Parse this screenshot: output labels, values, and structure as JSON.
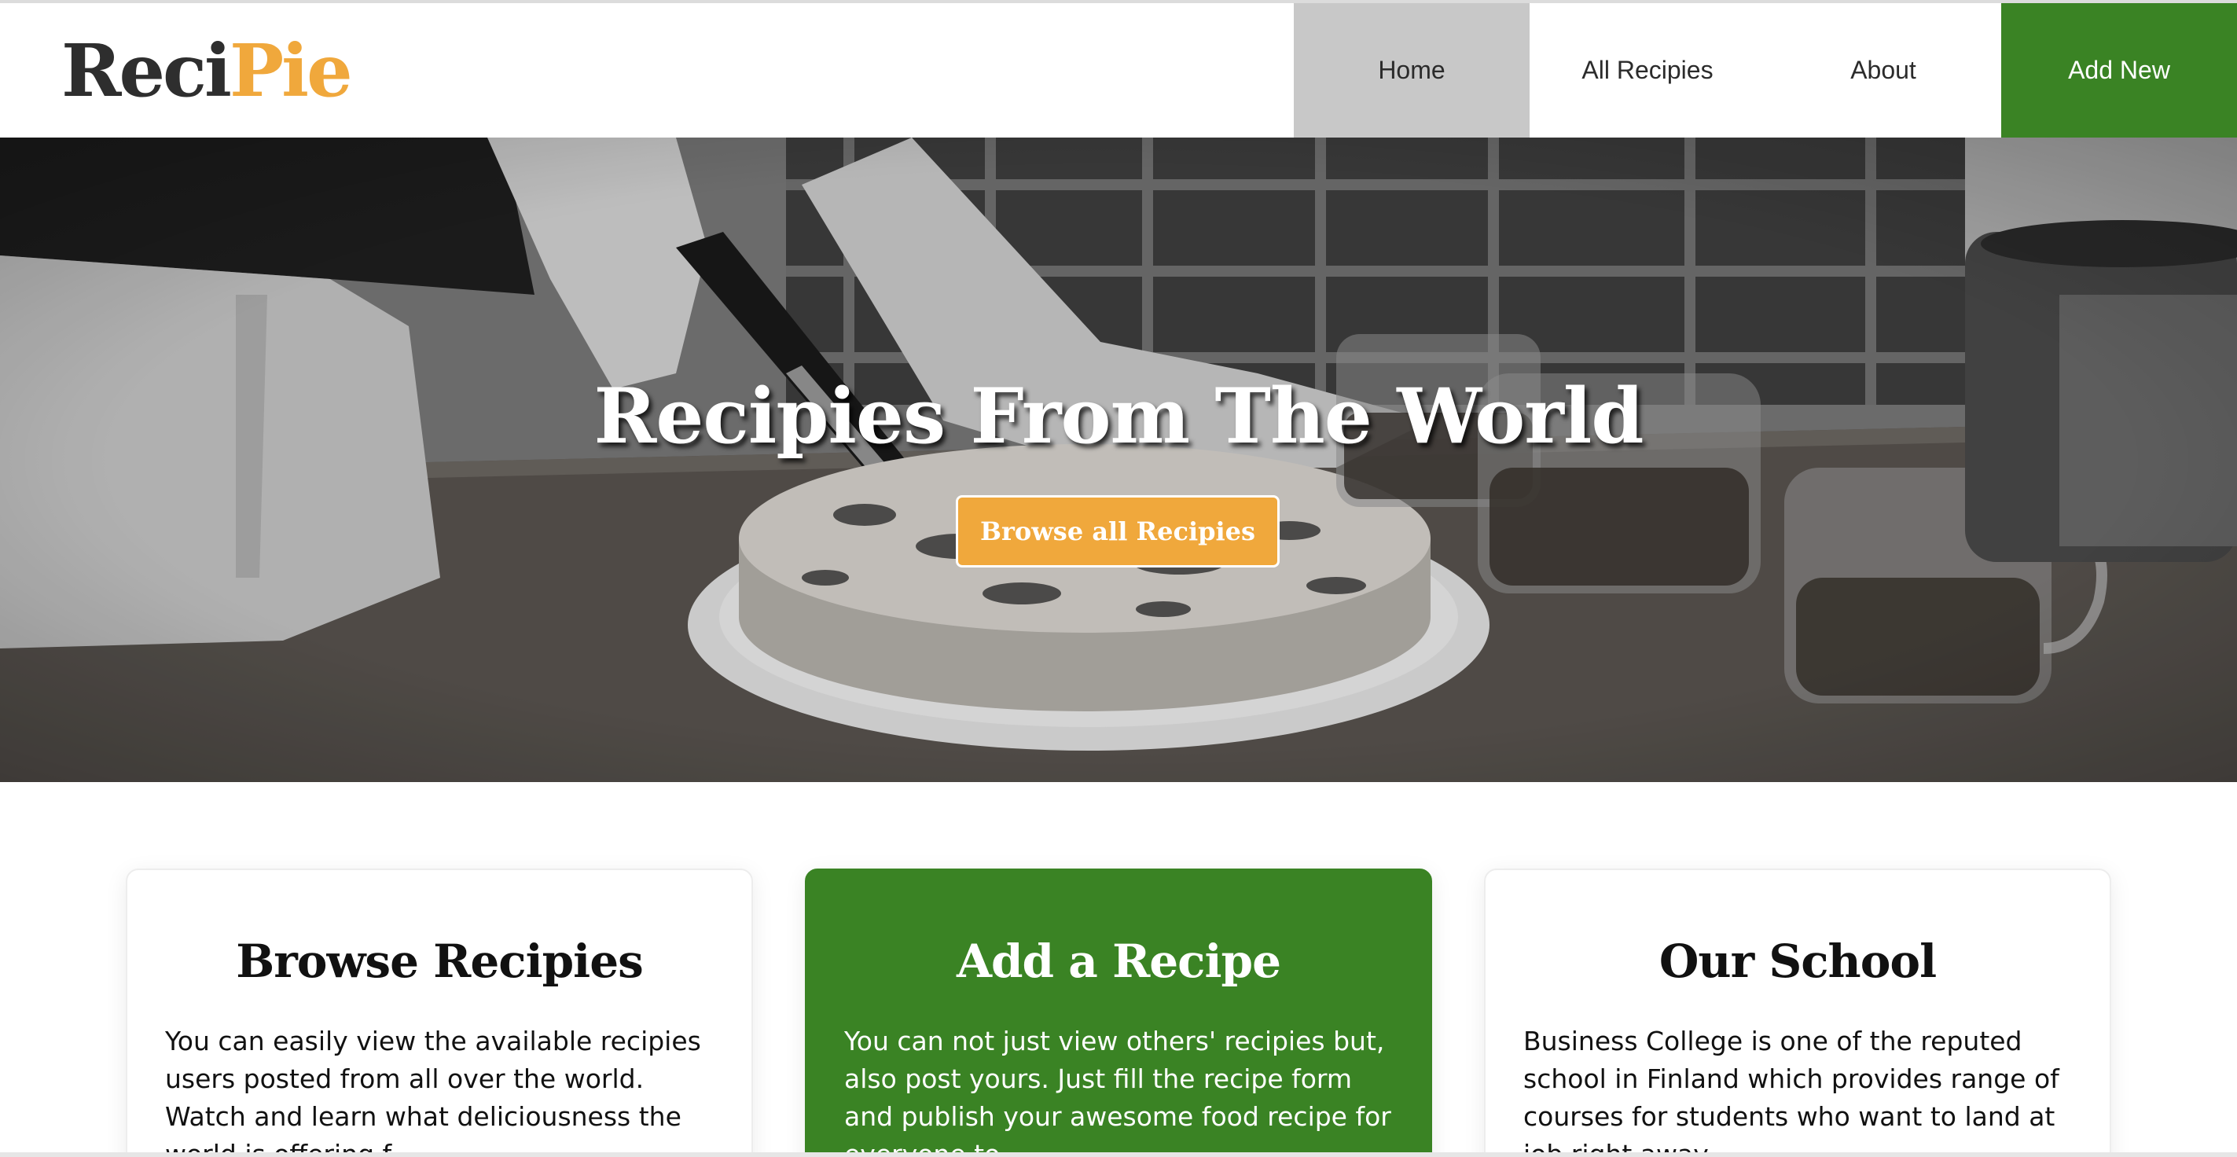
{
  "brand": {
    "logo_part1": "Reci",
    "logo_part2": "Pie"
  },
  "nav": {
    "items": [
      {
        "label": "Home",
        "active": true
      },
      {
        "label": "All Recipies",
        "active": false
      },
      {
        "label": "About",
        "active": false
      },
      {
        "label": "Add New",
        "active": false
      }
    ]
  },
  "hero": {
    "title": "Recipies From The World",
    "button_label": "Browse all Recipies"
  },
  "cards": [
    {
      "title": "Browse Recipies",
      "text": "You can easily view the available recipies users posted from all over the world. Watch and learn what deliciousness the world is offering f..."
    },
    {
      "title": "Add a Recipe",
      "text": "You can not just view others' recipies but, also post yours. Just fill the recipe form and publish your awesome food recipe for everyone to"
    },
    {
      "title": "Our School",
      "text": "Business College is one of the reputed school in Finland which provides range of courses for students who want to land at job right away."
    }
  ],
  "colors": {
    "accent_orange": "#f0a83c",
    "brand_green": "#3a8324",
    "nav_active_gray": "#c8c8c8",
    "logo_dark": "#2e2e2e"
  }
}
